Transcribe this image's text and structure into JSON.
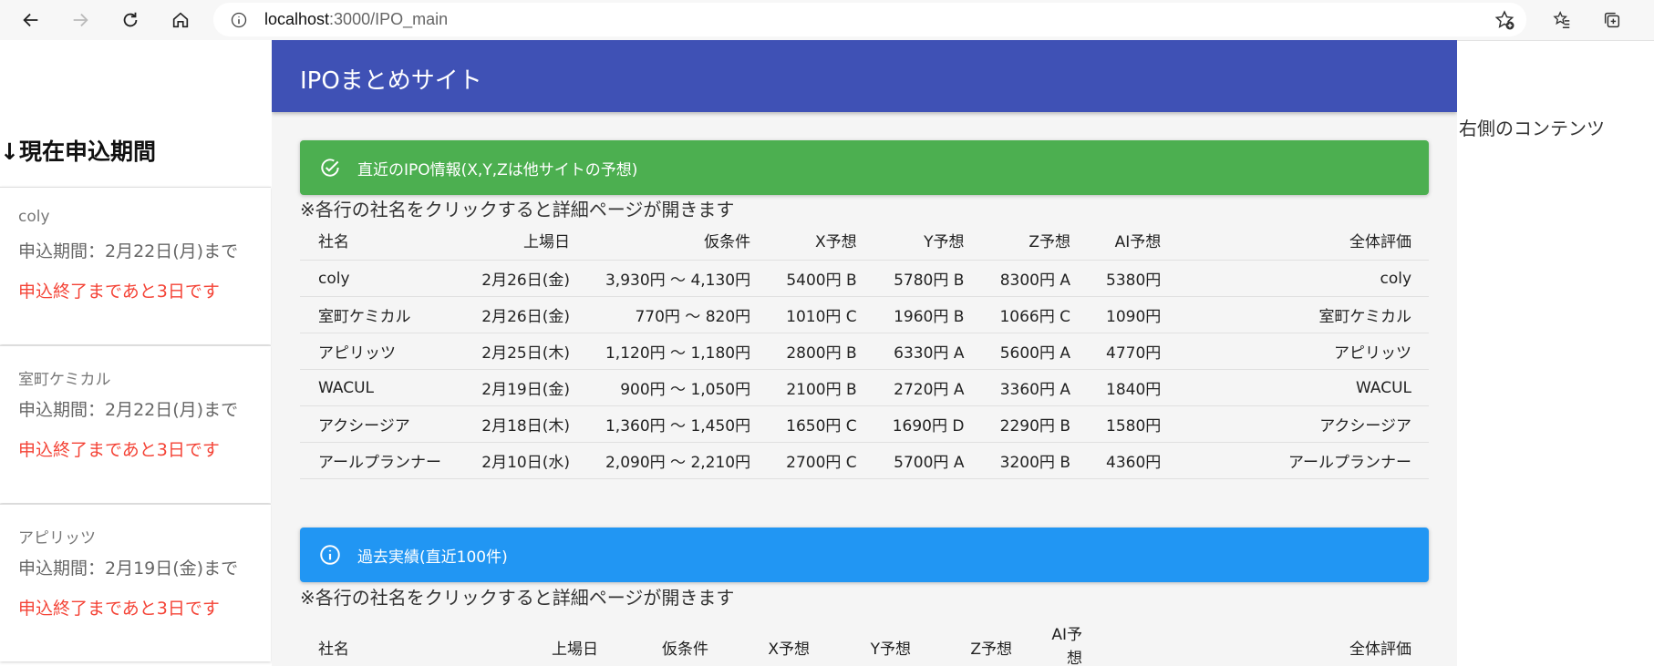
{
  "browser": {
    "url_host": "localhost",
    "url_rest": ":3000/IPO_main"
  },
  "header": {
    "title": "IPOまとめサイト"
  },
  "sidebar": {
    "title": "↓現在申込期間",
    "cards": [
      {
        "name": "coly",
        "period": "申込期間：2月22日(月)まで",
        "remaining": "申込終了まであと3日です"
      },
      {
        "name": "室町ケミカル",
        "period": "申込期間：2月22日(月)まで",
        "remaining": "申込終了まであと3日です"
      },
      {
        "name": "アピリッツ",
        "period": "申込期間：2月19日(金)まで",
        "remaining": "申込終了まであと3日です"
      }
    ]
  },
  "recent": {
    "alert": "直近のIPO情報(X,Y,Zは他サイトの予想)",
    "note": "※各行の社名をクリックすると詳細ページが開きます",
    "headers": [
      "社名",
      "上場日",
      "仮条件",
      "X予想",
      "Y予想",
      "Z予想",
      "AI予想",
      "全体評価"
    ],
    "rows": [
      [
        "coly",
        "2月26日(金)",
        "3,930円 〜 4,130円",
        "5400円 B",
        "5780円 B",
        "8300円 A",
        "5380円",
        "coly"
      ],
      [
        "室町ケミカル",
        "2月26日(金)",
        "770円 〜 820円",
        "1010円 C",
        "1960円 B",
        "1066円 C",
        "1090円",
        "室町ケミカル"
      ],
      [
        "アピリッツ",
        "2月25日(木)",
        "1,120円 〜 1,180円",
        "2800円 B",
        "6330円 A",
        "5600円 A",
        "4770円",
        "アピリッツ"
      ],
      [
        "WACUL",
        "2月19日(金)",
        "900円 〜 1,050円",
        "2100円 B",
        "2720円 A",
        "3360円 A",
        "1840円",
        "WACUL"
      ],
      [
        "アクシージア",
        "2月18日(木)",
        "1,360円 〜 1,450円",
        "1650円 C",
        "1690円 D",
        "2290円 B",
        "1580円",
        "アクシージア"
      ],
      [
        "アールプランナー",
        "2月10日(水)",
        "2,090円 〜 2,210円",
        "2700円 C",
        "5700円 A",
        "3200円 B",
        "4360円",
        "アールプランナー"
      ]
    ]
  },
  "past": {
    "alert": "過去実績(直近100件)",
    "note": "※各行の社名をクリックすると詳細ページが開きます",
    "headers": [
      "社名",
      "上場日",
      "仮条件",
      "X予想",
      "Y予想",
      "Z予想",
      "AI予想",
      "全体評価"
    ]
  },
  "right": {
    "text": "右側のコンテンツ"
  },
  "colors": {
    "appbar": "#3f51b5",
    "success": "#4caf50",
    "info": "#2196f3",
    "remaining_text": "#f44336"
  },
  "icons": [
    "back-icon",
    "forward-icon",
    "reload-icon",
    "home-icon",
    "info-icon",
    "favorite-add-icon",
    "favorites-icon",
    "collections-icon",
    "check-circle-icon",
    "info-circle-icon"
  ]
}
